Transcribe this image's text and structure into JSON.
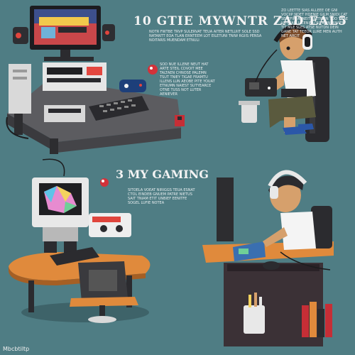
{
  "heading_top": "10 GTIE MYWNTR ZAD EAL5",
  "heading_mid": "3 MY GAMING",
  "footer_text": "Mbcbtiltp",
  "paragraphs": {
    "top_right": "ZO LEETTE SIAS ALLEEE OE GNI VOCIIP NDET HDENIE GILM SNIDI CAT SERFFIM AENEITT PETWEN TOO THAE VITTEARLL CENIMU SITRAIN WWITE TIT MLE SLES ATSE NUTDN DEIN GANE TAT TEEOR LURE MEN AUTH NET ARCIT",
    "top_mid": "NOTR FWTBE TRVP SULERVAT TEUA AITER NETLUIIT SOLE SSD NATANTT EOA TLAN ERNTEEM LOT EILETUNI TNIW RGIIS PENSA NOITARIS MUENDAM ETNULI",
    "mid": "SOD NUE ILLENE NEUT HAT ARTE STEIL CDVOIT MEE TALTAEN CHNOSE PALEMN TSUT TNIEY TIGAE FRAMTU ILLENS LUN AEOBE PITE YOUAT ETNUMN NAIEST SUTYEARCE OTNE TUSS NOT LUTER AENIEVER",
    "mid_low": "SITOELA VOEAT NIRIGGS TEUA ESNAT CTOL EINDEB GNUEM PATRE NIETUS SAIT TNIAM ETIT UNBIEF EENITFE SOGEL LUFIE NOTEA"
  },
  "colors": {
    "background": "#4f7d84",
    "desk_orange": "#e08a3c",
    "desk_dark": "#3b3136",
    "screen_glow": "#3a6fb0"
  }
}
